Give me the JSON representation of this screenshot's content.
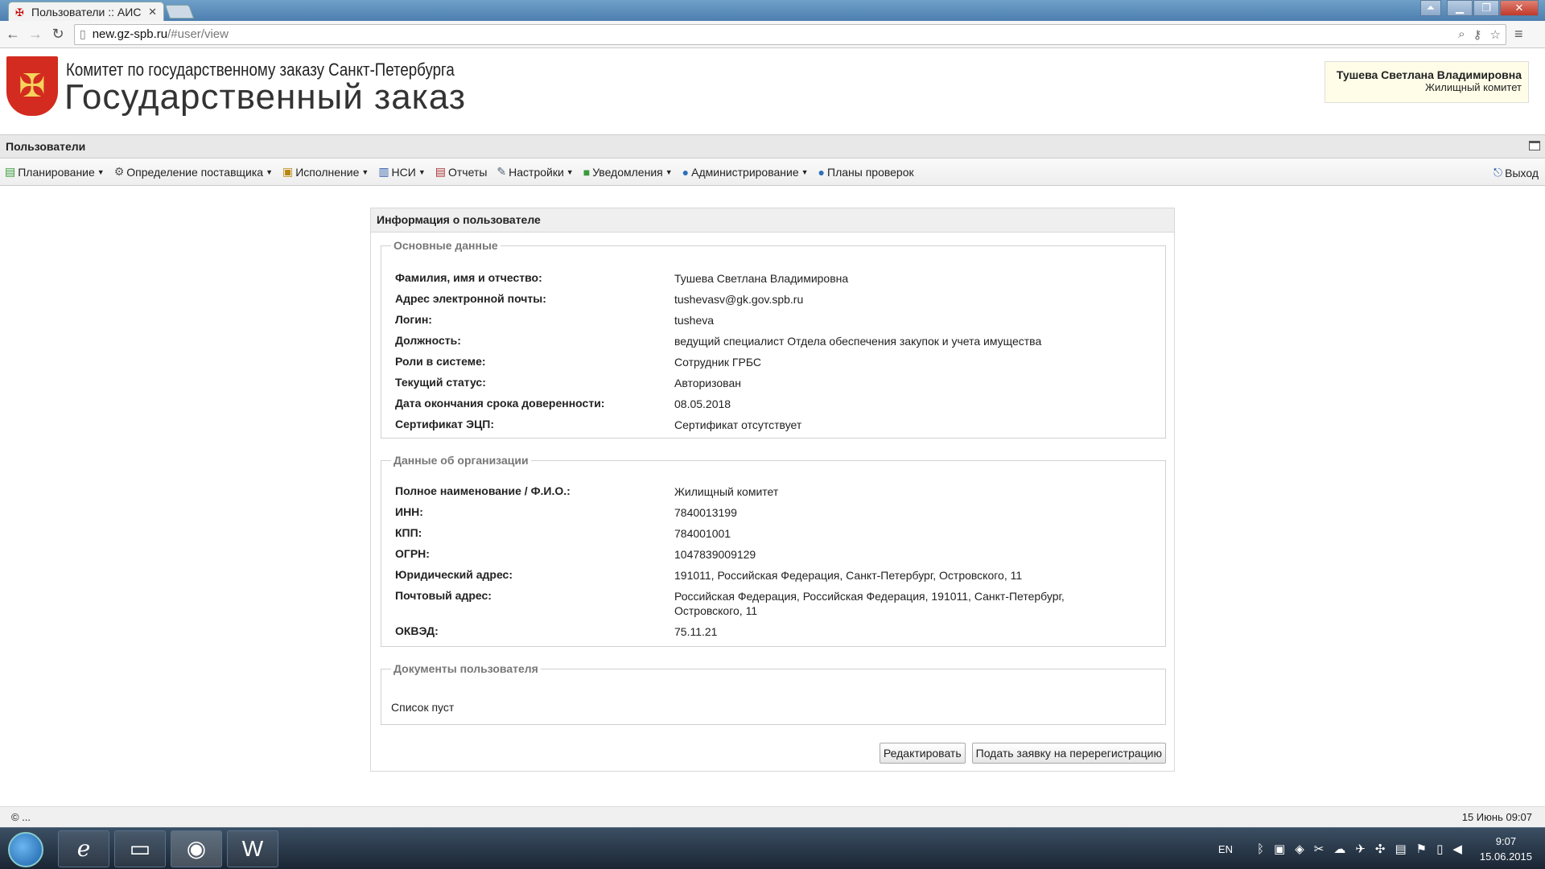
{
  "browser": {
    "tab_title": "Пользователи :: АИС",
    "url_host": "new.gz-spb.ru",
    "url_path": "/#user/view"
  },
  "header": {
    "org_name": "Комитет по государственному заказу Санкт-Петербурга",
    "brand": "Государственный заказ",
    "user_name": "Тушева Светлана Владимировна",
    "user_org": "Жилищный комитет"
  },
  "module_title": "Пользователи",
  "menu": [
    {
      "label": "Планирование",
      "icon": "planning-icon",
      "dropdown": true
    },
    {
      "label": "Определение поставщика",
      "icon": "gear-icon",
      "dropdown": true
    },
    {
      "label": "Исполнение",
      "icon": "execution-icon",
      "dropdown": true
    },
    {
      "label": "НСИ",
      "icon": "book-icon",
      "dropdown": true
    },
    {
      "label": "Отчеты",
      "icon": "report-icon",
      "dropdown": false
    },
    {
      "label": "Настройки",
      "icon": "wrench-icon",
      "dropdown": true
    },
    {
      "label": "Уведомления",
      "icon": "notification-icon",
      "dropdown": true
    },
    {
      "label": "Администрирование",
      "icon": "user-icon",
      "dropdown": true
    },
    {
      "label": "Планы проверок",
      "icon": "user-icon",
      "dropdown": false
    }
  ],
  "exit_label": "Выход",
  "panel": {
    "title": "Информация о пользователе",
    "basic": {
      "legend": "Основные данные",
      "rows": [
        {
          "k": "Фамилия, имя и отчество:",
          "v": "Тушева Светлана Владимировна"
        },
        {
          "k": "Адрес электронной почты:",
          "v": "tushevasv@gk.gov.spb.ru"
        },
        {
          "k": "Логин:",
          "v": "tusheva"
        },
        {
          "k": "Должность:",
          "v": "ведущий специалист Отдела обеспечения закупок и учета имущества"
        },
        {
          "k": "Роли в системе:",
          "v": "Сотрудник ГРБС"
        },
        {
          "k": "Текущий статус:",
          "v": "Авторизован"
        },
        {
          "k": "Дата окончания срока доверенности:",
          "v": "08.05.2018"
        },
        {
          "k": "Сертификат ЭЦП:",
          "v": "Сертификат отсутствует"
        }
      ]
    },
    "org": {
      "legend": "Данные об организации",
      "rows": [
        {
          "k": "Полное наименование / Ф.И.О.:",
          "v": "Жилищный комитет"
        },
        {
          "k": "ИНН:",
          "v": "7840013199"
        },
        {
          "k": "КПП:",
          "v": "784001001"
        },
        {
          "k": "ОГРН:",
          "v": "1047839009129"
        },
        {
          "k": "Юридический адрес:",
          "v": "191011, Российская Федерация, Санкт-Петербург, Островского, 11"
        },
        {
          "k": "Почтовый адрес:",
          "v": "Российская Федерация, Российская Федерация, 191011, Санкт-Петербург, Островского, 11"
        },
        {
          "k": "ОКВЭД:",
          "v": "75.11.21"
        }
      ]
    },
    "docs": {
      "legend": "Документы пользователя",
      "empty": "Список пуст"
    },
    "edit_button": "Редактировать",
    "rereg_button": "Подать заявку на перерегистрацию"
  },
  "footer": {
    "copyright": "© ...",
    "datetime": "15 Июнь 09:07"
  },
  "taskbar": {
    "lang": "EN",
    "time": "9:07",
    "date": "15.06.2015"
  }
}
